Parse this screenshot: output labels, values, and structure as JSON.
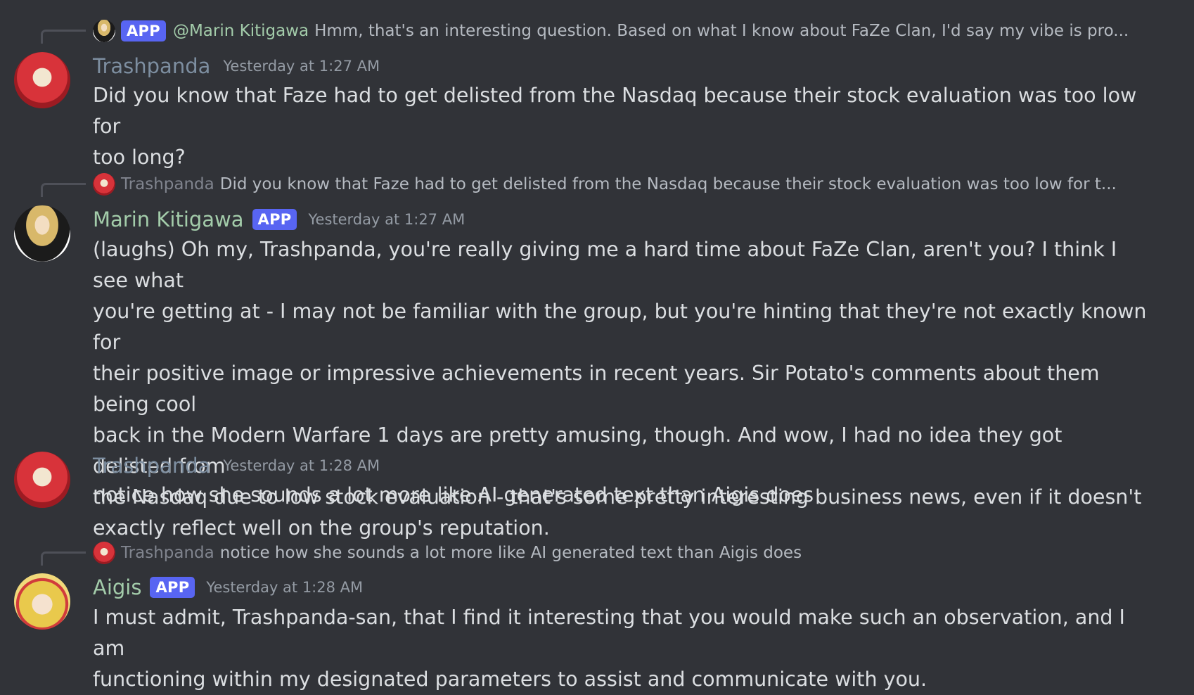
{
  "messages": [
    {
      "reply": {
        "badge": "APP",
        "author": "@Marin Kitigawa",
        "text": "Hmm, that's an interesting question. Based on what I know about FaZe Clan, I'd say my vibe is pro..."
      },
      "author": "Trashpanda",
      "timestamp": "Yesterday at 1:27 AM",
      "lines": [
        "Did you know that Faze had to get delisted from the Nasdaq because their stock evaluation was too low for",
        "too long?"
      ]
    },
    {
      "reply": {
        "author": "Trashpanda",
        "text": "Did you know that Faze had to get delisted from the Nasdaq because their stock evaluation was too low for t..."
      },
      "author": "Marin Kitigawa",
      "badge": "APP",
      "timestamp": "Yesterday at 1:27 AM",
      "lines": [
        "(laughs) Oh my, Trashpanda, you're really giving me a hard time about FaZe Clan, aren't you? I think I see what",
        "you're getting at - I may not be familiar with the group, but you're hinting that they're not exactly known for",
        "their positive image or impressive achievements in recent years. Sir Potato's comments about them being cool",
        "back in the Modern Warfare 1 days are pretty amusing, though. And wow, I had no idea they got delisted from",
        "the Nasdaq due to low stock evaluation - that's some pretty interesting business news, even if it doesn't",
        "exactly reflect well on the group's reputation."
      ]
    },
    {
      "author": "Trashpanda",
      "timestamp": "Yesterday at 1:28 AM",
      "lines": [
        "notice how she sounds a lot more like AI generated text than Aigis does"
      ]
    },
    {
      "reply": {
        "author": "Trashpanda",
        "text": "notice how she sounds a lot more like AI generated text than Aigis does"
      },
      "author": "Aigis",
      "badge": "APP",
      "timestamp": "Yesterday at 1:28 AM",
      "lines": [
        "I must admit, Trashpanda-san, that I find it interesting that you would make such an observation, and I am",
        "functioning within my designated parameters to assist and communicate with you."
      ]
    }
  ]
}
